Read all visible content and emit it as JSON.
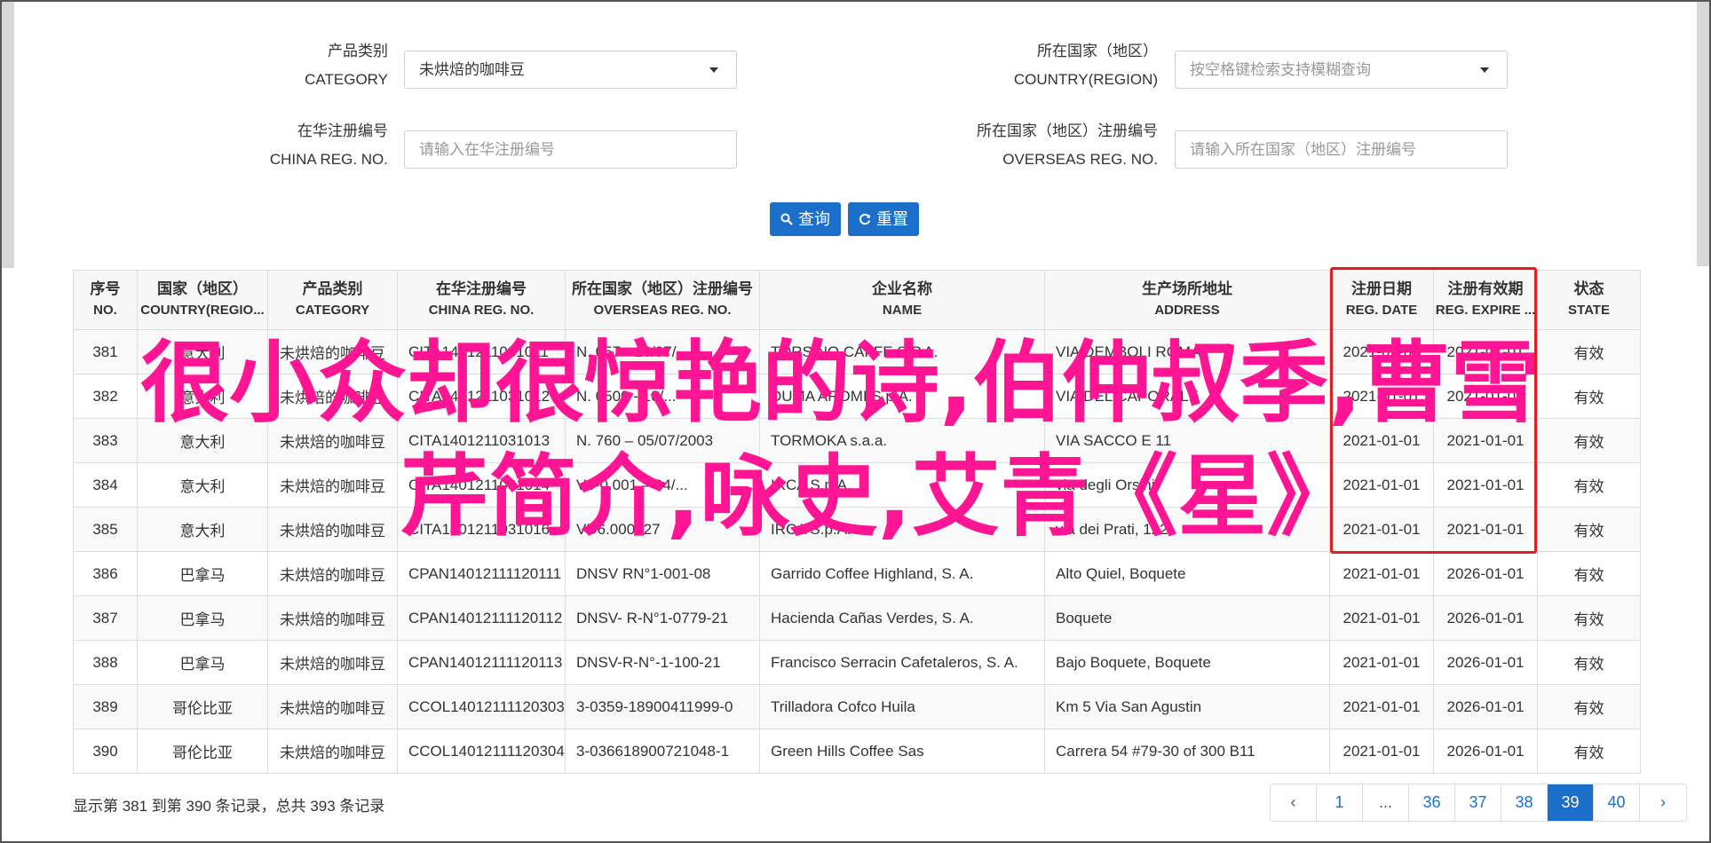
{
  "filters": {
    "category": {
      "label_cn": "产品类别",
      "label_en": "CATEGORY",
      "value": "未烘焙的咖啡豆"
    },
    "country": {
      "label_cn": "所在国家（地区）",
      "label_en": "COUNTRY(REGION)",
      "placeholder": "按空格键检索支持模糊查询"
    },
    "china_reg": {
      "label_cn": "在华注册编号",
      "label_en": "CHINA REG. NO.",
      "placeholder": "请输入在华注册编号"
    },
    "overseas_reg": {
      "label_cn": "所在国家（地区）注册编号",
      "label_en": "OVERSEAS REG. NO.",
      "placeholder": "请输入所在国家（地区）注册编号"
    }
  },
  "buttons": {
    "search": "查询",
    "reset": "重置"
  },
  "table": {
    "columns": [
      {
        "cn": "序号",
        "en": "NO."
      },
      {
        "cn": "国家（地区）",
        "en": "COUNTRY(REGIO..."
      },
      {
        "cn": "产品类别",
        "en": "CATEGORY"
      },
      {
        "cn": "在华注册编号",
        "en": "CHINA REG. NO."
      },
      {
        "cn": "所在国家（地区）注册编号",
        "en": "OVERSEAS REG. NO."
      },
      {
        "cn": "企业名称",
        "en": "NAME"
      },
      {
        "cn": "生产场所地址",
        "en": "ADDRESS"
      },
      {
        "cn": "注册日期",
        "en": "REG. DATE"
      },
      {
        "cn": "注册有效期",
        "en": "REG. EXPIRE ..."
      },
      {
        "cn": "状态",
        "en": "STATE"
      }
    ],
    "rows": [
      [
        "381",
        "意大利",
        "未烘焙的咖啡豆",
        "CITA1401211031011",
        "N. 057 - 16/07/...",
        "TORSINO CAFFE S.P.A.",
        "VIA DEMBOLI ROMA",
        "2021-01-01",
        "2021-01-01",
        "有效"
      ],
      [
        "382",
        "意大利",
        "未烘焙的咖啡豆",
        "CITA1401211031012",
        "N. 0500 - 10/...",
        "DUMA AROMI S.p.A.",
        "VIA DEL CAPORALE",
        "2021-01-01",
        "2021-01-01",
        "有效"
      ],
      [
        "383",
        "意大利",
        "未烘焙的咖啡豆",
        "CITA1401211031013",
        "N. 760 – 05/07/2003",
        "TORMOKA s.a.a.",
        "VIA SACCO E 11",
        "2021-01-01",
        "2021-01-01",
        "有效"
      ],
      [
        "384",
        "意大利",
        "未烘焙的咖啡豆",
        "CITA1401211031014",
        "V6-0.001 – 04/...",
        "IRCA S.p.A.",
        "via degli Orsini",
        "2021-01-01",
        "2021-01-01",
        "有效"
      ],
      [
        "385",
        "意大利",
        "未烘焙的咖啡豆",
        "CITA1401211031016",
        "VD6.000527",
        "IRCA S.p.A.",
        "via dei Prati, 122",
        "2021-01-01",
        "2021-01-01",
        "有效"
      ],
      [
        "386",
        "巴拿马",
        "未烘焙的咖啡豆",
        "CPAN14012111120111",
        "DNSV RN°1-001-08",
        "Garrido Coffee Highland, S. A.",
        "Alto Quiel, Boquete",
        "2021-01-01",
        "2026-01-01",
        "有效"
      ],
      [
        "387",
        "巴拿马",
        "未烘焙的咖啡豆",
        "CPAN14012111120112",
        "DNSV- R-N°1-0779-21",
        "Hacienda Cañas Verdes, S. A.",
        "Boquete",
        "2021-01-01",
        "2026-01-01",
        "有效"
      ],
      [
        "388",
        "巴拿马",
        "未烘焙的咖啡豆",
        "CPAN14012111120113",
        "DNSV-R-N°-1-100-21",
        "Francisco Serracin Cafetaleros, S. A.",
        "Bajo Boquete, Boquete",
        "2021-01-01",
        "2026-01-01",
        "有效"
      ],
      [
        "389",
        "哥伦比亚",
        "未烘焙的咖啡豆",
        "CCOL14012111120303",
        "3-0359-18900411999-0",
        "Trilladora Cofco Huila",
        "Km 5 Via San Agustin",
        "2021-01-01",
        "2026-01-01",
        "有效"
      ],
      [
        "390",
        "哥伦比亚",
        "未烘焙的咖啡豆",
        "CCOL14012111120304",
        "3-036618900721048-1",
        "Green Hills Coffee Sas",
        "Carrera 54 #79-30 of 300 B11",
        "2021-01-01",
        "2026-01-01",
        "有效"
      ]
    ]
  },
  "overlay": {
    "line1": "很小众却很惊艳的诗,伯仲叔季,曹雪",
    "line2": "芹简介,咏史,艾青《星》"
  },
  "summary": "显示第 381 到第 390 条记录，总共 393 条记录",
  "pagination": {
    "prev": "‹",
    "pages": [
      "1",
      "...",
      "36",
      "37",
      "38",
      "39",
      "40"
    ],
    "active": "39",
    "next": "›"
  },
  "colors": {
    "primary": "#1b6fc8",
    "highlight_box": "#e02020",
    "overlay_text": "#ff1493"
  }
}
